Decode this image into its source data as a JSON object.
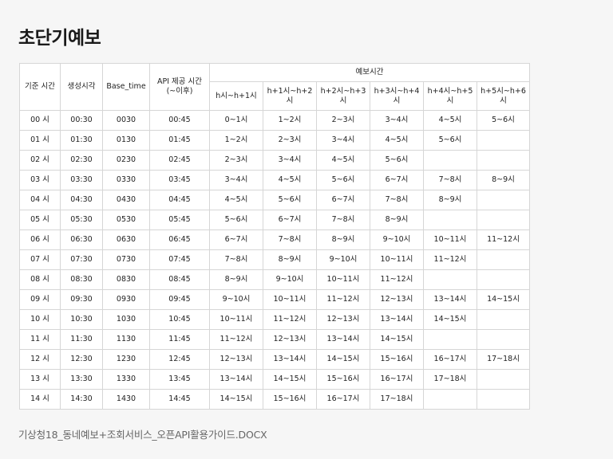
{
  "title": "초단기예보",
  "footer": "기상청18_동네예보+조회서비스_오픈API활용가이드.DOCX",
  "table": {
    "headers": {
      "base_hour": "기준 시간",
      "created": "생성시각",
      "base_time": "Base_time",
      "api_time": "API 제공 시간 (~이후)",
      "forecast_group": "예보시간",
      "forecast": [
        "h시~h+1시",
        "h+1시~h+2시",
        "h+2시~h+3시",
        "h+3시~h+4시",
        "h+4시~h+5시",
        "h+5시~h+6시"
      ]
    },
    "rows": [
      {
        "base_hour": "00 시",
        "created": "00:30",
        "base_time": "0030",
        "api_time": "00:45",
        "f": [
          "0~1시",
          "1~2시",
          "2~3시",
          "3~4시",
          "4~5시",
          "5~6시"
        ]
      },
      {
        "base_hour": "01 시",
        "created": "01:30",
        "base_time": "0130",
        "api_time": "01:45",
        "f": [
          "1~2시",
          "2~3시",
          "3~4시",
          "4~5시",
          "5~6시",
          ""
        ]
      },
      {
        "base_hour": "02 시",
        "created": "02:30",
        "base_time": "0230",
        "api_time": "02:45",
        "f": [
          "2~3시",
          "3~4시",
          "4~5시",
          "5~6시",
          "",
          ""
        ]
      },
      {
        "base_hour": "03 시",
        "created": "03:30",
        "base_time": "0330",
        "api_time": "03:45",
        "f": [
          "3~4시",
          "4~5시",
          "5~6시",
          "6~7시",
          "7~8시",
          "8~9시"
        ]
      },
      {
        "base_hour": "04 시",
        "created": "04:30",
        "base_time": "0430",
        "api_time": "04:45",
        "f": [
          "4~5시",
          "5~6시",
          "6~7시",
          "7~8시",
          "8~9시",
          ""
        ]
      },
      {
        "base_hour": "05 시",
        "created": "05:30",
        "base_time": "0530",
        "api_time": "05:45",
        "f": [
          "5~6시",
          "6~7시",
          "7~8시",
          "8~9시",
          "",
          ""
        ]
      },
      {
        "base_hour": "06 시",
        "created": "06:30",
        "base_time": "0630",
        "api_time": "06:45",
        "f": [
          "6~7시",
          "7~8시",
          "8~9시",
          "9~10시",
          "10~11시",
          "11~12시"
        ]
      },
      {
        "base_hour": "07 시",
        "created": "07:30",
        "base_time": "0730",
        "api_time": "07:45",
        "f": [
          "7~8시",
          "8~9시",
          "9~10시",
          "10~11시",
          "11~12시",
          ""
        ]
      },
      {
        "base_hour": "08 시",
        "created": "08:30",
        "base_time": "0830",
        "api_time": "08:45",
        "f": [
          "8~9시",
          "9~10시",
          "10~11시",
          "11~12시",
          "",
          ""
        ]
      },
      {
        "base_hour": "09 시",
        "created": "09:30",
        "base_time": "0930",
        "api_time": "09:45",
        "f": [
          "9~10시",
          "10~11시",
          "11~12시",
          "12~13시",
          "13~14시",
          "14~15시"
        ]
      },
      {
        "base_hour": "10 시",
        "created": "10:30",
        "base_time": "1030",
        "api_time": "10:45",
        "f": [
          "10~11시",
          "11~12시",
          "12~13시",
          "13~14시",
          "14~15시",
          ""
        ]
      },
      {
        "base_hour": "11 시",
        "created": "11:30",
        "base_time": "1130",
        "api_time": "11:45",
        "f": [
          "11~12시",
          "12~13시",
          "13~14시",
          "14~15시",
          "",
          ""
        ]
      },
      {
        "base_hour": "12 시",
        "created": "12:30",
        "base_time": "1230",
        "api_time": "12:45",
        "f": [
          "12~13시",
          "13~14시",
          "14~15시",
          "15~16시",
          "16~17시",
          "17~18시"
        ]
      },
      {
        "base_hour": "13 시",
        "created": "13:30",
        "base_time": "1330",
        "api_time": "13:45",
        "f": [
          "13~14시",
          "14~15시",
          "15~16시",
          "16~17시",
          "17~18시",
          ""
        ]
      },
      {
        "base_hour": "14 시",
        "created": "14:30",
        "base_time": "1430",
        "api_time": "14:45",
        "f": [
          "14~15시",
          "15~16시",
          "16~17시",
          "17~18시",
          "",
          ""
        ]
      }
    ]
  }
}
